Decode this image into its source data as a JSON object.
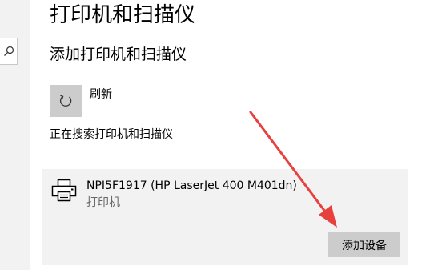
{
  "page": {
    "title": "打印机和扫描仪"
  },
  "sidebar": {
    "search_icon": "search-icon"
  },
  "section": {
    "title": "添加打印机和扫描仪"
  },
  "refresh": {
    "label": "刷新",
    "icon": "refresh-icon"
  },
  "status": {
    "text": "正在搜索打印机和扫描仪"
  },
  "device": {
    "name": "NPI5F1917 (HP LaserJet 400 M401dn)",
    "type": "打印机",
    "icon": "printer-icon",
    "add_button_label": "添加设备"
  },
  "colors": {
    "annotation_arrow": "#e8403c",
    "card_background": "#f2f2f2",
    "button_background": "#cccccc"
  }
}
